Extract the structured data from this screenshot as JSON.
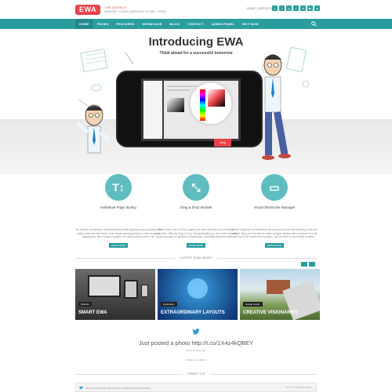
{
  "header": {
    "logo_text": "EWA",
    "tagline_1": "THE AGENCY",
    "tagline_2": "WHERE YOUR DREAMS COME TRUE",
    "top_links": "HOME | SUPPORT |",
    "social_icons": [
      "facebook-icon",
      "twitter-icon",
      "google-icon",
      "vimeo-icon",
      "linkedin-icon",
      "youtube-icon",
      "dribbble-icon"
    ]
  },
  "nav": {
    "items": [
      "HOME",
      "PAGES",
      "FEATURES",
      "SHOWCASE",
      "BLOG",
      "CONTACT",
      "ADMIN PANEL",
      "BUY NOW"
    ],
    "active_index": 0
  },
  "hero": {
    "title": "Introducing EWA",
    "subtitle": "Think ahead for a successful tomorrow",
    "badge": "blog"
  },
  "features": [
    {
      "icon": "text-styling-icon",
      "glyph": "T↕",
      "title": "Individual Page Styling",
      "desc": "We include an extensive advanced admin panel allowing users to quickly and easily customize the theme. From simply selecting brand or color mode, to adjusting the top or bottom margins, the admin panel covers it all.",
      "button": "LEARN MORE"
    },
    {
      "icon": "drag-drop-icon",
      "glyph": "⤡",
      "title": "Drag & Drop Module",
      "desc": "Select from a set of HTML, jquery and more deal with tons of themes shortcodes. With the Drag & Drop Themes Builder you can create beautiful layouts through our advanced visual editor. Incredibly awesome features.",
      "button": "LEARN MORE"
    },
    {
      "icon": "laptop-icon",
      "glyph": "▭",
      "title": "Visual Shortcode Manager",
      "desc": "Visual Composer for WordPress will save you tons of time working on the site content. Now you'll be able to create complex layouts within minutes! It's built on top of the modern technologies - get the best for your lovely website!",
      "button": "LEARN MORE"
    }
  ],
  "news": {
    "section_title": "LATEST EWA NEWS",
    "items": [
      {
        "label": "Website",
        "caption": "SMART EWA"
      },
      {
        "label": "Application",
        "caption": "EXTRAORDINARY LAYOUTS"
      },
      {
        "label": "Design Studio",
        "caption": "CREATIVE VISIONARIES"
      }
    ]
  },
  "tweet": {
    "text": "Just posted a photo http://t.co/1X4z4kQBEY",
    "time": "about 15 days ago",
    "follow": "Follow us on twitter",
    "section_title": "TWEET US",
    "box_text": "Let us know how we can help your company think better faster",
    "box_meta": "via Oscar TEAM Themeable"
  },
  "colors": {
    "brand": "#e8434a",
    "accent": "#2a9d9f",
    "icon_circle": "#5fbdbf"
  }
}
